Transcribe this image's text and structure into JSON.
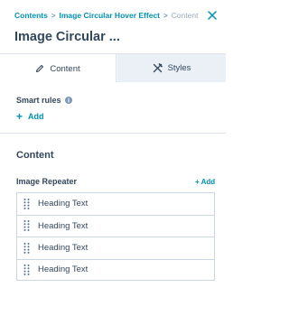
{
  "breadcrumb": {
    "items": [
      "Contents",
      "Image Circular Hover Effect",
      "Content"
    ],
    "separator": ">"
  },
  "header": {
    "title": "Image Circular ..."
  },
  "tabs": [
    {
      "label": "Content",
      "icon": "pencil-icon",
      "active": true
    },
    {
      "label": "Styles",
      "icon": "brush-icon",
      "active": false
    }
  ],
  "smart_rules": {
    "label": "Smart rules",
    "add_label": "Add"
  },
  "content": {
    "heading": "Content",
    "repeater": {
      "label": "Image Repeater",
      "add_label": "+ Add",
      "items": [
        "Heading Text",
        "Heading Text",
        "Heading Text",
        "Heading Text"
      ]
    }
  },
  "colors": {
    "link": "#0091ae",
    "text": "#33475b",
    "border": "#cbd6e2"
  }
}
